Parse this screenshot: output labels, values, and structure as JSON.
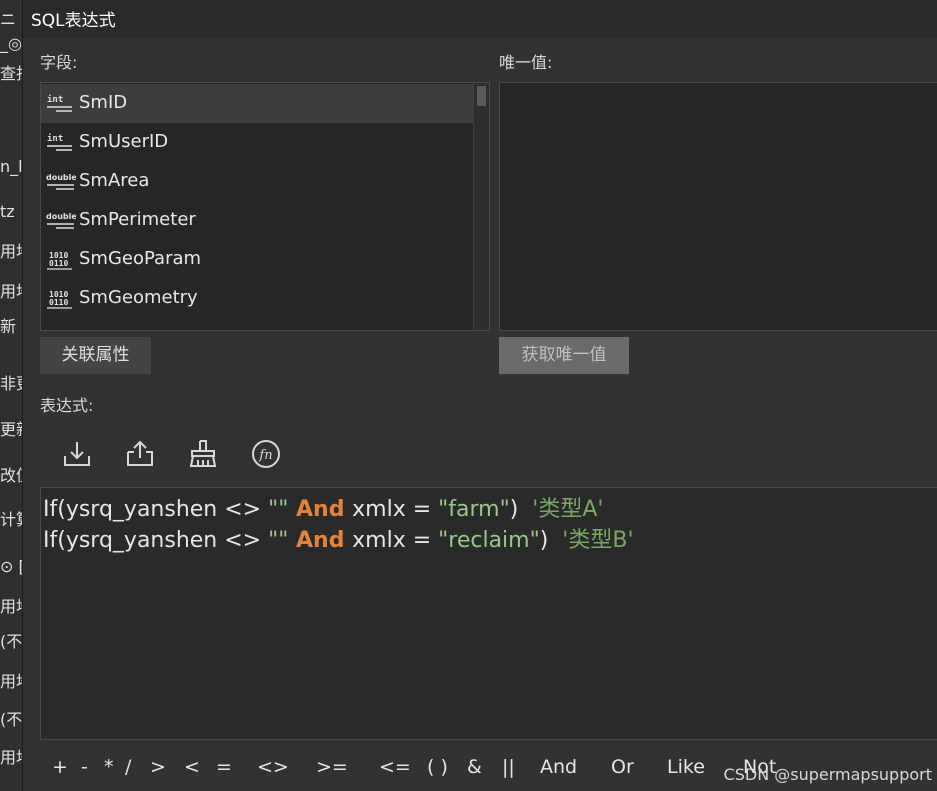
{
  "background_window": {
    "fragments": [
      "ニ",
      "_◎",
      "查找",
      "n_l",
      "tz",
      "用地",
      "用地",
      "新",
      "非更",
      "更新",
      "改值",
      "计算",
      "⊙ [",
      "用地",
      "(不",
      "用地",
      "(不",
      "用地"
    ]
  },
  "dialog": {
    "title": "SQL表达式",
    "fields_label": "字段:",
    "unique_label": "唯一值:",
    "fields": [
      {
        "type_icon": "int",
        "name": "SmID",
        "selected": true
      },
      {
        "type_icon": "int",
        "name": "SmUserID",
        "selected": false
      },
      {
        "type_icon": "double",
        "name": "SmArea",
        "selected": false
      },
      {
        "type_icon": "double",
        "name": "SmPerimeter",
        "selected": false
      },
      {
        "type_icon": "binary",
        "name": "SmGeoParam",
        "selected": false
      },
      {
        "type_icon": "binary",
        "name": "SmGeometry",
        "selected": false
      }
    ],
    "related_attr_button": "关联属性",
    "get_unique_button": "获取唯一值",
    "expression_label": "表达式:",
    "toolbar_icons": [
      "import-icon",
      "export-icon",
      "clear-icon",
      "function-icon"
    ],
    "expression_lines": [
      {
        "p1": "If(ysrq_yanshen <> ",
        "s1": "\"\"",
        "kw": " And ",
        "p2": "xmlx = ",
        "s2": "\"farm\"",
        "p3": ")  ",
        "sq": "'类型A'"
      },
      {
        "p1": "If(ysrq_yanshen <> ",
        "s1": "\"\"",
        "kw": " And ",
        "p2": "xmlx = ",
        "s2": "\"reclaim\"",
        "p3": ")  ",
        "sq": "'类型B'"
      }
    ],
    "operators": [
      "+",
      "-",
      "*",
      "/",
      ">",
      "<",
      "=",
      "<>",
      ">=",
      "<=",
      "( )",
      "&",
      "||",
      "And",
      "Or",
      "Like",
      "Not"
    ]
  },
  "watermark": "CSDN @supermapsupport"
}
